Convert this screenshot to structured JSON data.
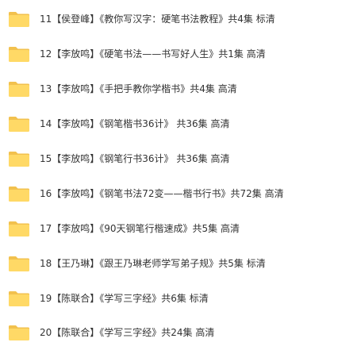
{
  "folders": [
    {
      "label": "11【侯登峰】《教你写汉字：硬笔书法教程》共4集 标清",
      "icon": "folder-icon"
    },
    {
      "label": "12【李放鸣】《硬笔书法——书写好人生》共1集 高清",
      "icon": "folder-icon"
    },
    {
      "label": "13【李放鸣】《手把手教你学楷书》共4集 高清",
      "icon": "folder-icon"
    },
    {
      "label": "14【李放鸣】《钢笔楷书36计》 共36集 高清",
      "icon": "folder-icon"
    },
    {
      "label": "15【李放鸣】《钢笔行书36计》 共36集 高清",
      "icon": "folder-icon"
    },
    {
      "label": "16【李放鸣】《钢笔书法72变——楷书行书》共72集 高清",
      "icon": "folder-icon"
    },
    {
      "label": "17【李放鸣】《90天钢笔行楷速成》共5集 高清",
      "icon": "folder-icon"
    },
    {
      "label": "18【王乃琳】《跟王乃琳老师学写弟子规》共5集 标清",
      "icon": "folder-icon"
    },
    {
      "label": "19【陈联合】《学写三字经》共6集 标清",
      "icon": "folder-icon"
    },
    {
      "label": "20【陈联合】《学写三字经》共24集 高清",
      "icon": "folder-icon"
    }
  ],
  "colors": {
    "folder_body": "#FFD966",
    "folder_tab": "#F2C14E",
    "text": "#333333",
    "background": "#FFFFFF"
  }
}
